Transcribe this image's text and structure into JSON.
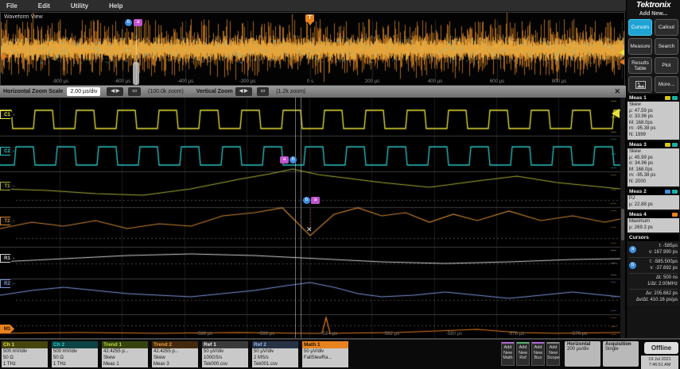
{
  "menu": {
    "items": [
      "File",
      "Edit",
      "Utility",
      "Help"
    ]
  },
  "overview": {
    "title": "Waveform View",
    "trigger_label": "T",
    "time_labels": [
      "-800 µs",
      "-600 µs",
      "-400 µs",
      "-200 µs",
      "0 s",
      "200 µs",
      "400 µs",
      "600 µs",
      "800 µs"
    ]
  },
  "zoom_bar": {
    "h_label": "Horizontal Zoom Scale",
    "h_scale": "2.00 µs/div",
    "arrows_label": "◀ ▶",
    "reset_label": "▭",
    "h_zoom": "(100.0k zoom)",
    "v_label": "Vertical Zoom",
    "v_zoom": "(1.2k zoom)",
    "close_label": "✕"
  },
  "zoom_view": {
    "time_labels": [
      "-588 µs",
      "-586 µs",
      "-584 µs",
      "-582 µs",
      "-580 µs",
      "-578 µs",
      "-576 µs"
    ],
    "cursor_a_label": "a",
    "cursor_b_label": "b",
    "handles": [
      {
        "label": "C1",
        "color": "#e8e138"
      },
      {
        "label": "C2",
        "color": "#29c5c5"
      },
      {
        "label": "T1",
        "color": "#a0a832"
      },
      {
        "label": "T2",
        "color": "#c8812e"
      },
      {
        "label": "R1",
        "color": "#cfcfcf"
      },
      {
        "label": "R2",
        "color": "#7b93d8"
      },
      {
        "label": "M1",
        "color": "#e8821e"
      }
    ]
  },
  "sidebar": {
    "brand": "Tektronix",
    "add_new_label": "Add New...",
    "buttons": [
      {
        "label": "Cursors",
        "active": true
      },
      {
        "label": "Callout"
      },
      {
        "label": "Measure"
      },
      {
        "label": "Search"
      },
      {
        "label": "Results Table"
      },
      {
        "label": "Plot"
      },
      {
        "label": "",
        "icon": "screenshot"
      },
      {
        "label": "More..."
      }
    ],
    "meas_panels": [
      {
        "title": "Meas 1",
        "chips": [
          "#d6c514",
          "#17b0a6"
        ],
        "name": "Skew",
        "lines": [
          "µ: 47.59 ps",
          "σ: 33.96 ps",
          "M: 168.0ps",
          "m: -95.38 ps",
          "N: 1999"
        ]
      },
      {
        "title": "Meas 3",
        "chips": [
          "#d6c514",
          "#17b0a6"
        ],
        "name": "Skew",
        "lines": [
          "µ: 45.99 ps",
          "σ: 34.96 ps",
          "M: 168.0ps",
          "m: -95.38 ps",
          "N: 2000"
        ]
      },
      {
        "title": "Meas 2",
        "chips": [
          "#3f8ede",
          "#17b0a6"
        ],
        "name": "PJ",
        "lines": [
          "µ: 22.88 ps"
        ]
      },
      {
        "title": "Meas 4",
        "chips": [
          "#e8821e"
        ],
        "name": "Maximum",
        "lines": [
          "µ: 269.3 ps"
        ]
      }
    ],
    "cursors_panel": {
      "title": "Cursors",
      "groups": [
        {
          "icon": "a",
          "rows": [
            "t: -585µs",
            "v: 167.990 ps"
          ]
        },
        {
          "icon": "b",
          "rows": [
            "t: -585.500µs",
            "v: -37.692 ps"
          ]
        },
        {
          "rows": [
            "Δt: 500 ns",
            "1/Δt: 2.00MHz"
          ]
        },
        {
          "rows": [
            "Δv: 205.682 ps",
            "Δv/Δt: 410.16 ps/µs"
          ]
        }
      ]
    }
  },
  "badges": [
    {
      "title": "Ch 1",
      "title_bg": "#45450f",
      "title_color": "#e8e138",
      "lines": [
        "500 mV/div",
        "50 Ω",
        "1 THz"
      ]
    },
    {
      "title": "Ch 2",
      "title_bg": "#0d4343",
      "title_color": "#2ad5d5",
      "lines": [
        "500 mV/div",
        "50 Ω",
        "1 THz"
      ]
    },
    {
      "title": "Trend 1",
      "title_bg": "#36430f",
      "title_color": "#b5d838",
      "lines": [
        "42.4255 p...",
        "Skew",
        "Meas 1"
      ]
    },
    {
      "title": "Trend 2",
      "title_bg": "#43290d",
      "title_color": "#e8a038",
      "lines": [
        "42.4255 p...",
        "Skew",
        "Meas 3"
      ]
    },
    {
      "title": "Ref 1",
      "title_bg": "#3a3a3a",
      "title_color": "#e8e8e8",
      "lines": [
        "50 µV/div",
        "100GS/s",
        "Tek000.csv"
      ]
    },
    {
      "title": "Ref 2",
      "title_bg": "#273244",
      "title_color": "#9ab8e8",
      "lines": [
        "50 µV/div",
        "2 MS/s",
        "Tek001.csv"
      ]
    },
    {
      "title": "Math 1",
      "title_bg": "#e8821e",
      "title_color": "#1d1200",
      "lines": [
        "50 µV/div",
        "FallSlewRa..."
      ]
    }
  ],
  "bottom_right": {
    "add_buttons": [
      {
        "lines": [
          "Add",
          "New",
          "Math"
        ],
        "accent": "#b06ad0"
      },
      {
        "lines": [
          "Add",
          "New",
          "Ref"
        ],
        "accent": "#58b070"
      },
      {
        "lines": [
          "Add",
          "New",
          "Bus"
        ],
        "accent": "#b06ad0"
      },
      {
        "lines": [
          "Add",
          "New",
          "Scope"
        ],
        "accent": "#8a8a8a"
      }
    ],
    "horizontal": {
      "title": "Horizontal",
      "value": "200 µs/div"
    },
    "acquisition": {
      "title": "Acquisition",
      "value": "Single"
    },
    "offline_label": "Offline",
    "date": "19 Jul 2021",
    "time": "7:46:51 AM"
  }
}
